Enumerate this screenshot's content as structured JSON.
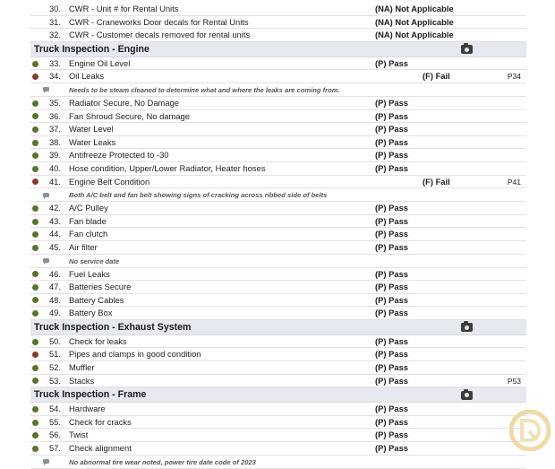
{
  "items": [
    {
      "kind": "item",
      "num": "30.",
      "label": "CWR - Unit # for Rental Units",
      "result": "(NA) Not Applicable",
      "status": "na"
    },
    {
      "kind": "item",
      "num": "31.",
      "label": "CWR - Craneworks Door decals for Rental Units",
      "result": "(NA) Not Applicable",
      "status": "na"
    },
    {
      "kind": "item",
      "num": "32.",
      "label": "CWR - Customer decals removed for rental units",
      "result": "(NA) Not Applicable",
      "status": "na"
    },
    {
      "kind": "section",
      "title": "Truck Inspection - Engine"
    },
    {
      "kind": "item",
      "num": "33.",
      "label": "Engine Oil Level",
      "result": "(P) Pass",
      "status": "pass"
    },
    {
      "kind": "item",
      "num": "34.",
      "label": "Oil Leaks",
      "result": "(F) Fail",
      "status": "fail",
      "photo": "P34"
    },
    {
      "kind": "note",
      "text": "Needs to be steam cleaned to determine what and where the leaks are coming from."
    },
    {
      "kind": "item",
      "num": "35.",
      "label": "Radiator Secure, No Damage",
      "result": "(P) Pass",
      "status": "pass"
    },
    {
      "kind": "item",
      "num": "36.",
      "label": "Fan Shroud Secure, No damage",
      "result": "(P) Pass",
      "status": "pass"
    },
    {
      "kind": "item",
      "num": "37.",
      "label": "Water Level",
      "result": "(P) Pass",
      "status": "pass"
    },
    {
      "kind": "item",
      "num": "38.",
      "label": "Water Leaks",
      "result": "(P) Pass",
      "status": "pass"
    },
    {
      "kind": "item",
      "num": "39.",
      "label": "Antifreeze Protected to -30",
      "result": "(P) Pass",
      "status": "pass"
    },
    {
      "kind": "item",
      "num": "40.",
      "label": "Hose condition, Upper/Lower Radiator, Heater hoses",
      "result": "(P) Pass",
      "status": "pass"
    },
    {
      "kind": "item",
      "num": "41.",
      "label": "Engine Belt Condition",
      "result": "(F) Fail",
      "status": "fail",
      "photo": "P41"
    },
    {
      "kind": "note",
      "text": "Both A/C belt and fan belt showing signs of cracking across ribbed side of belts"
    },
    {
      "kind": "item",
      "num": "42.",
      "label": "A/C Pulley",
      "result": "(P) Pass",
      "status": "pass"
    },
    {
      "kind": "item",
      "num": "43.",
      "label": "Fan blade",
      "result": "(P) Pass",
      "status": "pass"
    },
    {
      "kind": "item",
      "num": "44.",
      "label": "Fan clutch",
      "result": "(P) Pass",
      "status": "pass"
    },
    {
      "kind": "item",
      "num": "45.",
      "label": "Air filter",
      "result": "(P) Pass",
      "status": "pass"
    },
    {
      "kind": "note",
      "text": "No service date"
    },
    {
      "kind": "item",
      "num": "46.",
      "label": "Fuel Leaks",
      "result": "(P) Pass",
      "status": "pass"
    },
    {
      "kind": "item",
      "num": "47.",
      "label": "Batteries Secure",
      "result": "(P) Pass",
      "status": "pass"
    },
    {
      "kind": "item",
      "num": "48.",
      "label": "Battery Cables",
      "result": "(P) Pass",
      "status": "pass"
    },
    {
      "kind": "item",
      "num": "49.",
      "label": "Battery Box",
      "result": "(P) Pass",
      "status": "pass"
    },
    {
      "kind": "section",
      "title": "Truck Inspection - Exhaust System"
    },
    {
      "kind": "item",
      "num": "50.",
      "label": "Check for leaks",
      "result": "(P) Pass",
      "status": "pass"
    },
    {
      "kind": "item",
      "num": "51.",
      "label": "Pipes and clamps in good condition",
      "result": "(P) Pass",
      "status": "fail-dot"
    },
    {
      "kind": "item",
      "num": "52.",
      "label": "Muffler",
      "result": "(P) Pass",
      "status": "pass"
    },
    {
      "kind": "item",
      "num": "53.",
      "label": "Stacks",
      "result": "(P) Pass",
      "status": "pass",
      "photo": "P53"
    },
    {
      "kind": "section",
      "title": "Truck Inspection - Frame"
    },
    {
      "kind": "item",
      "num": "54.",
      "label": "Hardware",
      "result": "(P) Pass",
      "status": "pass"
    },
    {
      "kind": "item",
      "num": "55.",
      "label": "Check for cracks",
      "result": "(P) Pass",
      "status": "pass"
    },
    {
      "kind": "item",
      "num": "56.",
      "label": "Twist",
      "result": "(P) Pass",
      "status": "pass"
    },
    {
      "kind": "item",
      "num": "57.",
      "label": "Check alignment",
      "result": "(P) Pass",
      "status": "pass"
    },
    {
      "kind": "note",
      "text": "No abnormal tire wear noted, power tire date code of 2023"
    }
  ],
  "colors": {
    "pass_dot": "#58742a",
    "fail_dot": "#8a3a2c",
    "section_bg": "#e6e9ef"
  },
  "icons": {
    "section": "camera-icon",
    "note": "comment-icon",
    "watermark": "logo-watermark"
  }
}
